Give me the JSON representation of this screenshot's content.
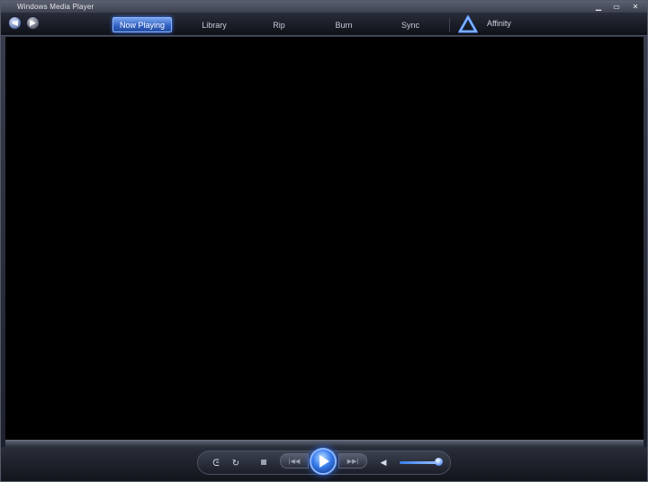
{
  "window": {
    "title": "Windows Media Player",
    "controls": {
      "minimize": "▁",
      "maximize": "▭",
      "close": "✕"
    }
  },
  "nav": {
    "back_icon": "back-arrow-icon",
    "forward_icon": "forward-arrow-icon",
    "tabs": [
      {
        "label": "Now Playing",
        "active": true
      },
      {
        "label": "Library",
        "active": false
      },
      {
        "label": "Rip",
        "active": false
      },
      {
        "label": "Burn",
        "active": false
      },
      {
        "label": "Sync",
        "active": false
      }
    ],
    "service": {
      "label": "Affinity",
      "icon": "affinity-logo-icon"
    }
  },
  "playback": {
    "shuffle_glyph": "ᕮ",
    "repeat_glyph": "↻",
    "prev_glyph": "|◀◀",
    "next_glyph": "▶▶|",
    "mute_glyph": "◀",
    "volume_level": 0.85
  },
  "colors": {
    "accent": "#3a7ef0",
    "video_bg": "#000000",
    "chrome": "#2a2e3b"
  }
}
